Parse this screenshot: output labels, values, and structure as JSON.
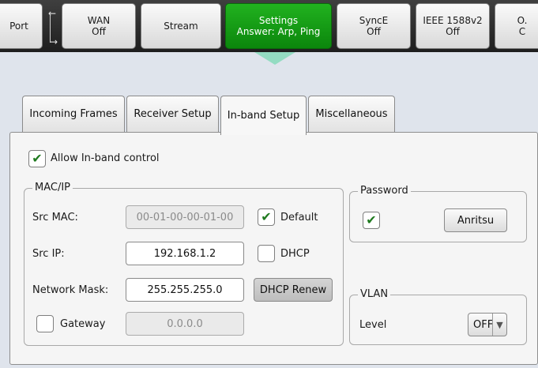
{
  "top_nav": {
    "port": "Port",
    "wan": {
      "title": "WAN",
      "state": "Off"
    },
    "stream": "Stream",
    "settings": {
      "title": "Settings",
      "state": "Answer: Arp, Ping"
    },
    "synce": {
      "title": "SyncE",
      "state": "Off"
    },
    "ieee": {
      "title": "IEEE 1588v2",
      "state": "Off"
    },
    "oam": {
      "title": "O.",
      "state": "C"
    }
  },
  "tabs": [
    {
      "label": "Incoming Frames"
    },
    {
      "label": "Receiver Setup"
    },
    {
      "label": "In-band Setup"
    },
    {
      "label": "Miscellaneous"
    }
  ],
  "inband": {
    "allow_label": "Allow In-band control",
    "allow_checked": true,
    "macip": {
      "title": "MAC/IP",
      "src_mac_label": "Src MAC:",
      "src_mac_value": "00-01-00-00-01-00",
      "default_label": "Default",
      "default_checked": true,
      "src_ip_label": "Src IP:",
      "src_ip_value": "192.168.1.2",
      "dhcp_label": "DHCP",
      "dhcp_checked": false,
      "mask_label": "Network Mask:",
      "mask_value": "255.255.255.0",
      "dhcp_renew_label": "DHCP Renew",
      "gateway_label": "Gateway",
      "gateway_checked": false,
      "gateway_value": "0.0.0.0"
    },
    "password": {
      "title": "Password",
      "enabled": true,
      "value": "Anritsu"
    },
    "vlan": {
      "title": "VLAN",
      "level_label": "Level",
      "level_value": "OFF",
      "arrow": "▼"
    }
  },
  "glyphs": {
    "check": "✔",
    "arrow_left": "←",
    "arrow_right": "→"
  },
  "colors": {
    "active_tab": "#0b860c",
    "check": "#1f7a1f"
  }
}
